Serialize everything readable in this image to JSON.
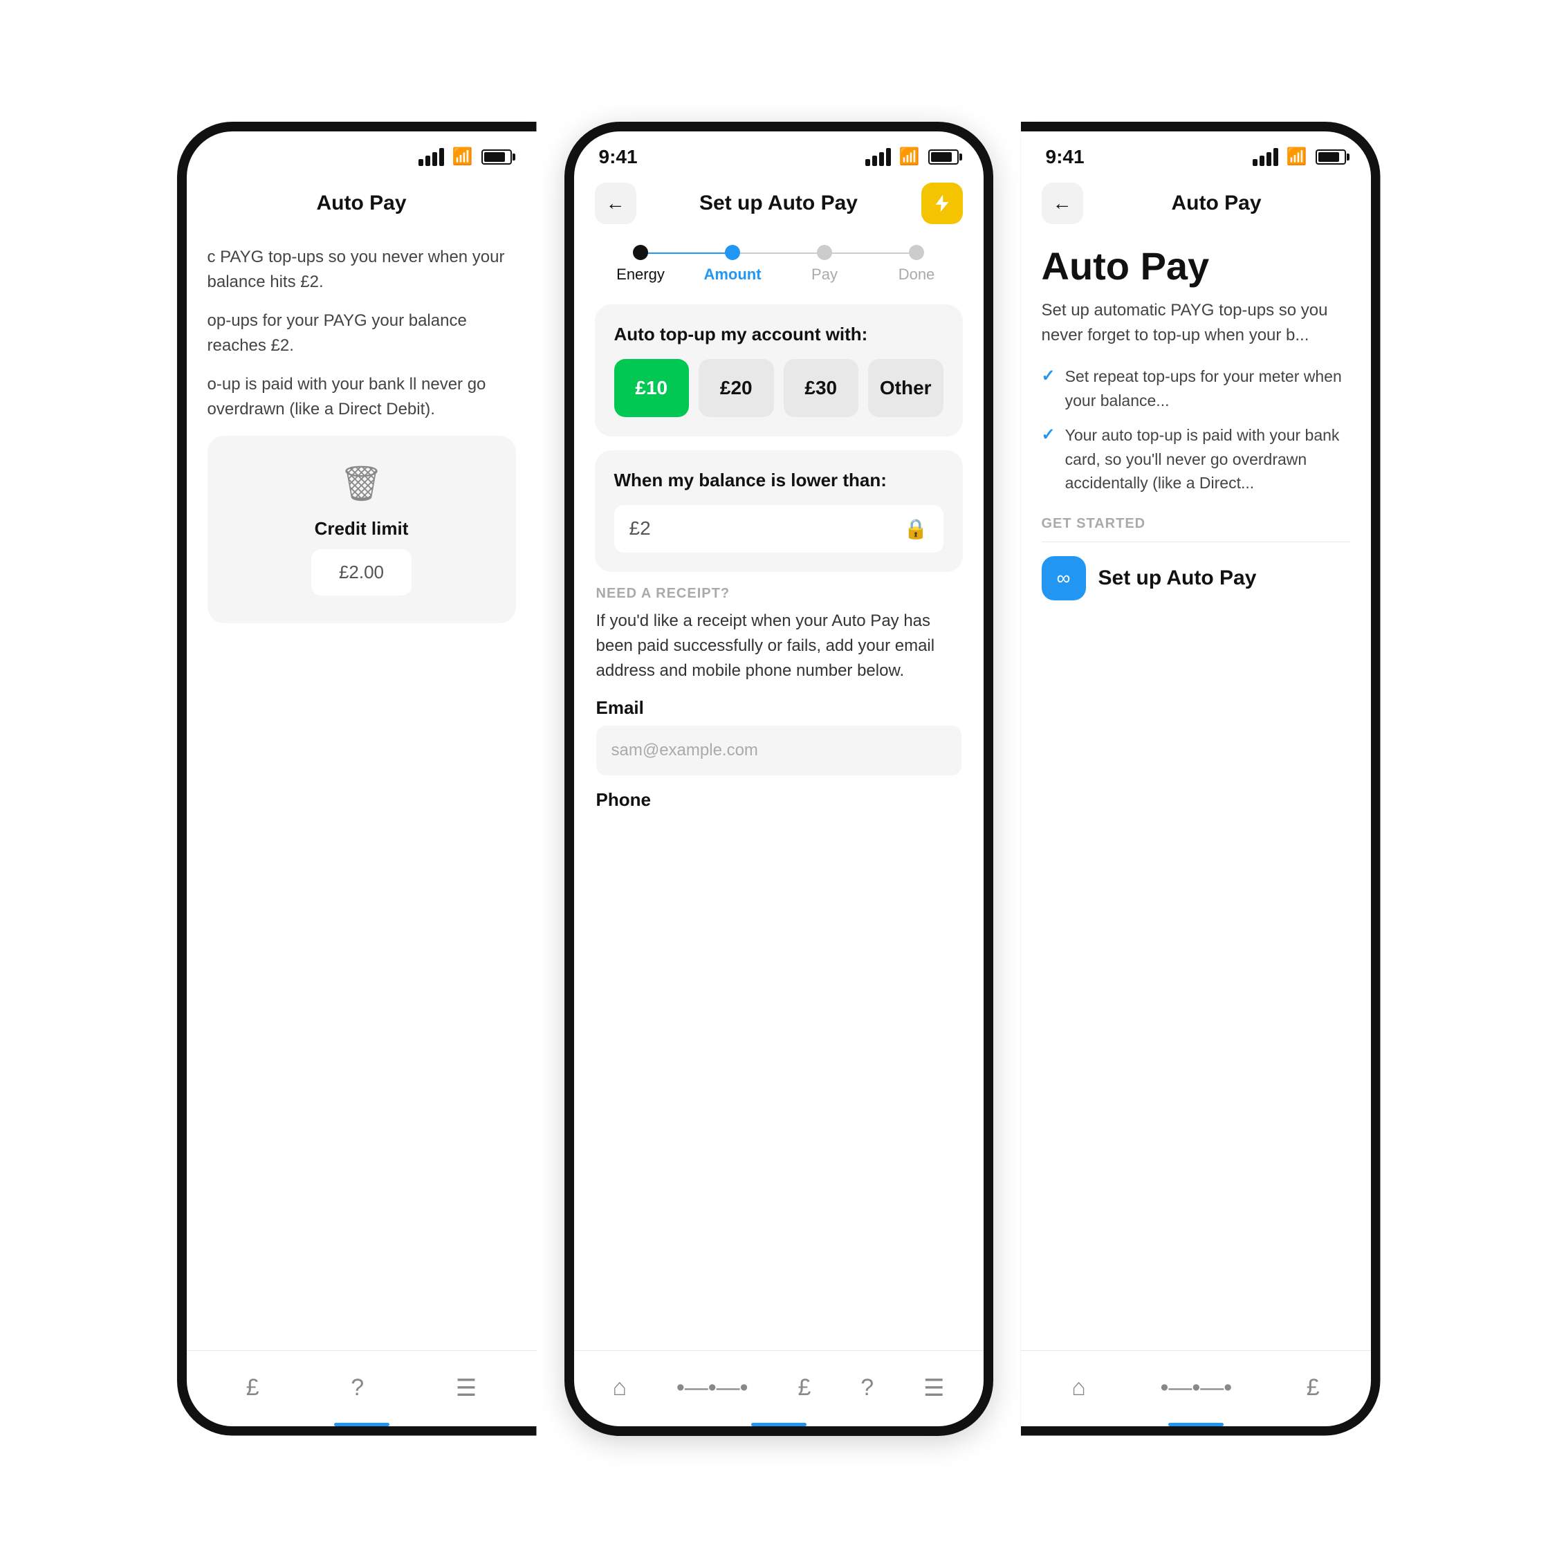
{
  "left_phone": {
    "title": "Auto Pay",
    "description_1": "c PAYG top-ups so you never when your balance hits £2.",
    "description_2": "op-ups for your PAYG your balance reaches £2.",
    "description_3": "o-up is paid with your bank ll never go overdrawn (like a Direct Debit).",
    "delete_section": {
      "credit_limit_label": "Credit limit",
      "credit_limit_value": "£2.00"
    },
    "nav_items": [
      "£",
      "?",
      "≡"
    ]
  },
  "center_phone": {
    "status_time": "9:41",
    "header_title": "Set up Auto Pay",
    "stepper": {
      "steps": [
        {
          "label": "Energy",
          "state": "filled"
        },
        {
          "label": "Amount",
          "state": "active"
        },
        {
          "label": "Pay",
          "state": "default"
        },
        {
          "label": "Done",
          "state": "default"
        }
      ]
    },
    "amount_card": {
      "title": "Auto top-up my account with:",
      "options": [
        {
          "label": "£10",
          "selected": true
        },
        {
          "label": "£20",
          "selected": false
        },
        {
          "label": "£30",
          "selected": false
        },
        {
          "label": "Other",
          "selected": false
        }
      ]
    },
    "balance_card": {
      "title": "When my balance is lower than:",
      "value": "£2"
    },
    "receipt": {
      "section_label": "NEED A RECEIPT?",
      "description": "If you'd like a receipt when your Auto Pay has been paid successfully or fails, add your email address and mobile phone number below.",
      "email_label": "Email",
      "email_placeholder": "sam@example.com",
      "phone_label": "Phone"
    },
    "nav_items": [
      "home",
      "connect",
      "account",
      "help",
      "menu"
    ]
  },
  "right_phone": {
    "status_time": "9:41",
    "header_title": "Auto Pay",
    "main_title": "Auto Pay",
    "description": "Set up automatic PAYG top-ups so you never forget to top-up when your b...",
    "check_items": [
      "Set repeat top-ups for your meter when your balance...",
      "Your auto top-up is paid with your bank card, so you'll never go overdrawn accidentally (like a Direct..."
    ],
    "get_started_label": "GET STARTED",
    "setup_btn_label": "Set up Auto Pay",
    "nav_items": [
      "home",
      "connect",
      "account"
    ]
  },
  "icons": {
    "back_arrow": "←",
    "lightning": "⚡",
    "lock": "🔒",
    "trash": "🗑",
    "infinity": "∞",
    "checkmark": "✓"
  }
}
